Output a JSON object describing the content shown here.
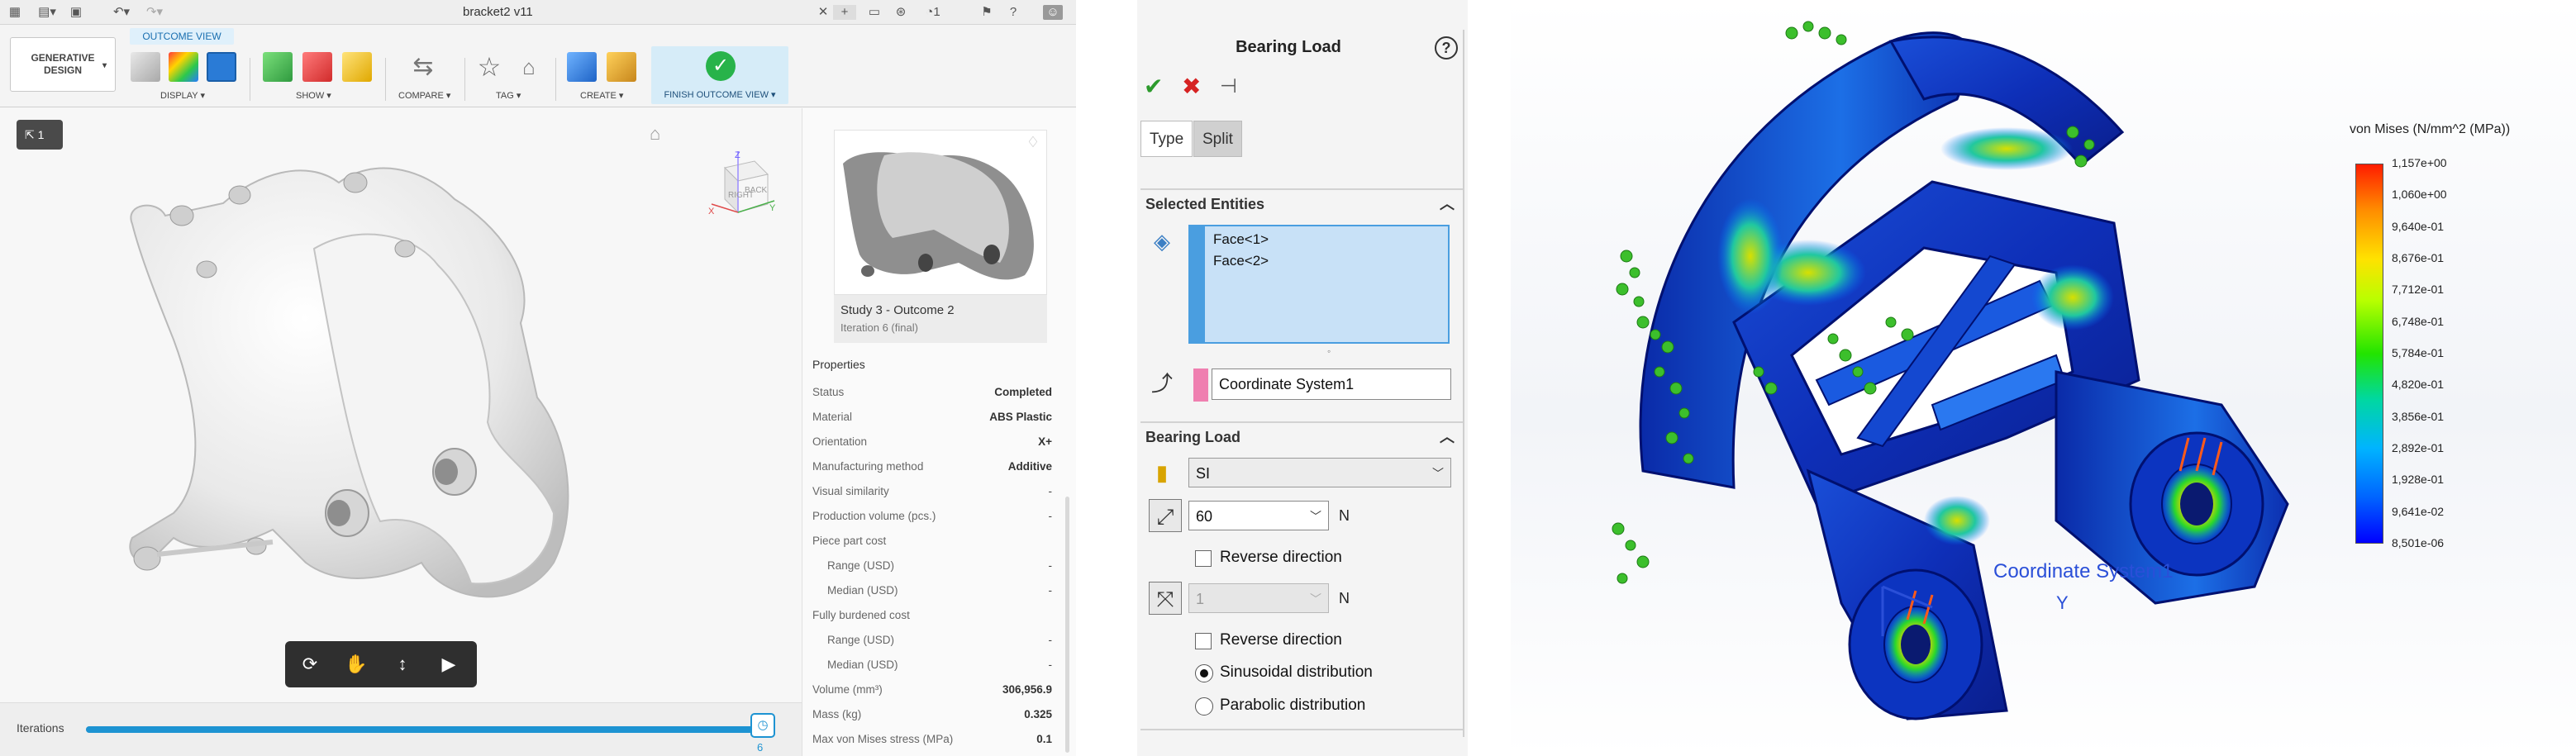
{
  "fusion": {
    "doc_title": "bracket2 v11",
    "generative_design_label": "GENERATIVE DESIGN",
    "outcome_view_tab": "OUTCOME VIEW",
    "groups": {
      "display": "DISPLAY ▾",
      "show": "SHOW ▾",
      "compare": "COMPARE ▾",
      "tag": "TAG ▾",
      "create": "CREATE ▾",
      "finish": "FINISH OUTCOME VIEW ▾"
    },
    "browser_count": "1",
    "viewcube": {
      "z": "Z",
      "x": "X",
      "y": "Y",
      "right": "RIGHT",
      "back": "BACK"
    },
    "thumbnail": {
      "title": "Study 3 - Outcome 2",
      "subtitle": "Iteration 6 (final)"
    },
    "properties": {
      "header": "Properties",
      "rows": [
        {
          "label": "Status",
          "value": "Completed"
        },
        {
          "label": "Material",
          "value": "ABS Plastic"
        },
        {
          "label": "Orientation",
          "value": "X+"
        },
        {
          "label": "Manufacturing method",
          "value": "Additive"
        },
        {
          "label": "Visual similarity",
          "value": "-"
        },
        {
          "label": "Production volume (pcs.)",
          "value": "-"
        },
        {
          "label": "Piece part cost",
          "value": ""
        },
        {
          "label": "Range (USD)",
          "value": "-"
        },
        {
          "label": "Median (USD)",
          "value": "-"
        },
        {
          "label": "Fully burdened cost",
          "value": ""
        },
        {
          "label": "Range (USD)",
          "value": "-"
        },
        {
          "label": "Median (USD)",
          "value": "-"
        },
        {
          "label": "Volume (mm³)",
          "value": "306,956.9"
        },
        {
          "label": "Mass (kg)",
          "value": "0.325"
        },
        {
          "label": "Max von Mises stress (MPa)",
          "value": "0.1"
        }
      ]
    },
    "iterations": {
      "label": "Iterations",
      "value": "6",
      "progress": 1.0
    }
  },
  "solidworks": {
    "title": "Bearing Load",
    "help": "?",
    "tabs": [
      "Type",
      "Split"
    ],
    "selected_entities": {
      "header": "Selected Entities",
      "items": [
        "Face<1>",
        "Face<2>"
      ],
      "coordinate_system": "Coordinate System1"
    },
    "bearing_load": {
      "header": "Bearing Load",
      "units": "SI",
      "force_value": "60",
      "force_unit": "N",
      "reverse_direction_1": "Reverse direction",
      "second_value": "1",
      "second_unit": "N",
      "reverse_direction_2": "Reverse direction",
      "sinusoidal": "Sinusoidal distribution",
      "parabolic": "Parabolic distribution",
      "selected_distribution": "sinusoidal"
    }
  },
  "fea": {
    "legend_title": "von Mises (N/mm^2 (MPa))",
    "legend_values": [
      "1,157e+00",
      "1,060e+00",
      "9,640e-01",
      "8,676e-01",
      "7,712e-01",
      "6,748e-01",
      "5,784e-01",
      "4,820e-01",
      "3,856e-01",
      "2,892e-01",
      "1,928e-01",
      "9,641e-02",
      "8,501e-06"
    ],
    "coordinate_system_label": "Coordinate System1",
    "axis_y": "Y",
    "colors": {
      "max": "#ff1c00",
      "min": "#0000ff",
      "fixture": "#3cbf2c"
    }
  }
}
